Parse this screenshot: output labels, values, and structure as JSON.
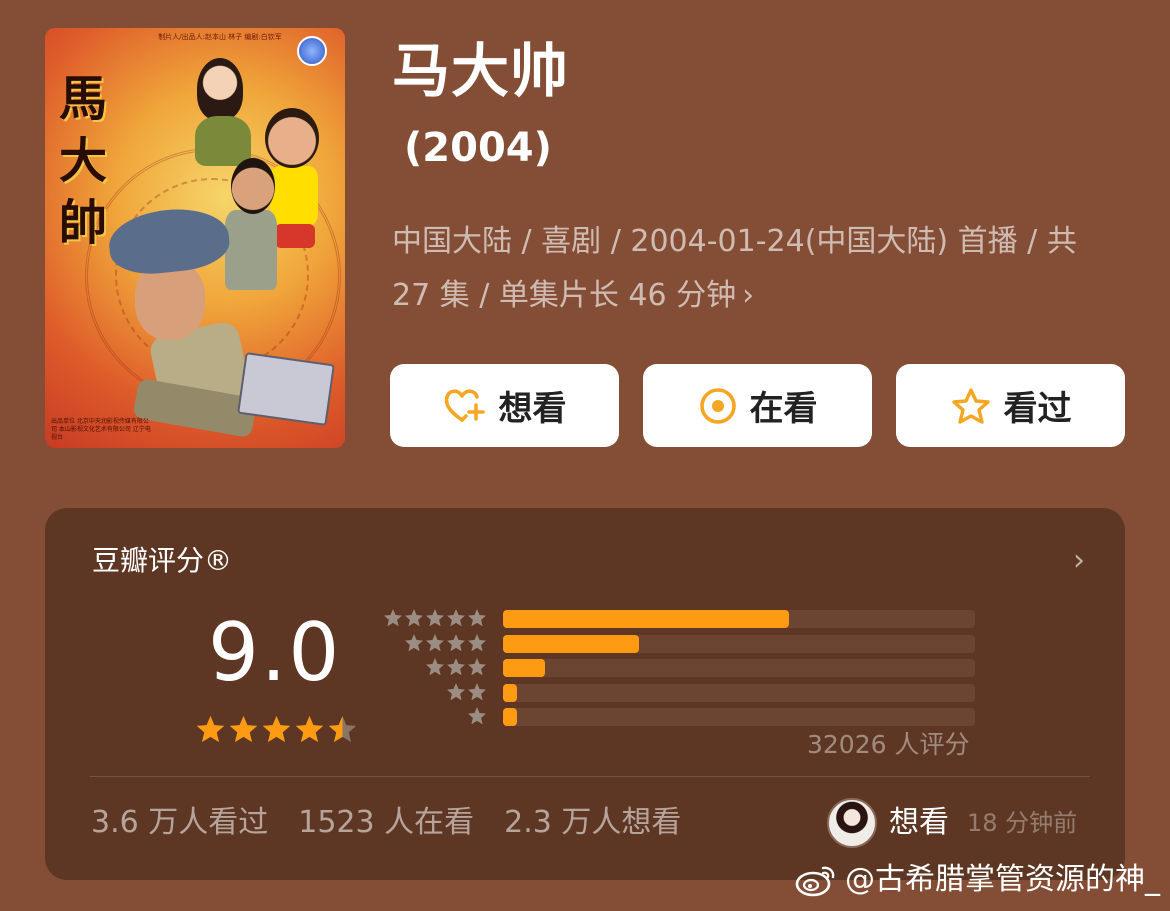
{
  "poster": {
    "title_chars": "馬大帥",
    "credits": "制片人/出品人:赵本山  林子   编剧:白钦军",
    "bottom_credits": "出品单位 北京中天润影视传媒有限公司 本山影视文化艺术有限公司 辽宁电视台"
  },
  "show": {
    "title": "马大帅",
    "year": "(2004)",
    "meta": "中国大陆 / 喜剧 / 2004-01-24(中国大陆) 首播 / 共 27 集 / 单集片长 46 分钟",
    "meta_chevron": "›"
  },
  "actions": {
    "want": "想看",
    "watching": "在看",
    "watched": "看过"
  },
  "rating": {
    "label": "豆瓣评分®",
    "chevron": "›",
    "score": "9.0",
    "score_stars": 4.5,
    "count_text": "32026 人评分",
    "distribution": [
      {
        "stars": 5,
        "fraction": 0.606
      },
      {
        "stars": 4,
        "fraction": 0.288
      },
      {
        "stars": 3,
        "fraction": 0.09
      },
      {
        "stars": 2,
        "fraction": 0.03
      },
      {
        "stars": 1,
        "fraction": 0.03
      }
    ],
    "colors": {
      "accent": "#ff9b12",
      "track": "#6b4531",
      "card": "#5d3723"
    }
  },
  "stats": {
    "watched": "3.6 万人看过",
    "watching": "1523 人在看",
    "want": "2.3 万人想看"
  },
  "user_status": {
    "action": "想看",
    "time": "18 分钟前"
  },
  "watermark": "@古希腊掌管资源的神_"
}
